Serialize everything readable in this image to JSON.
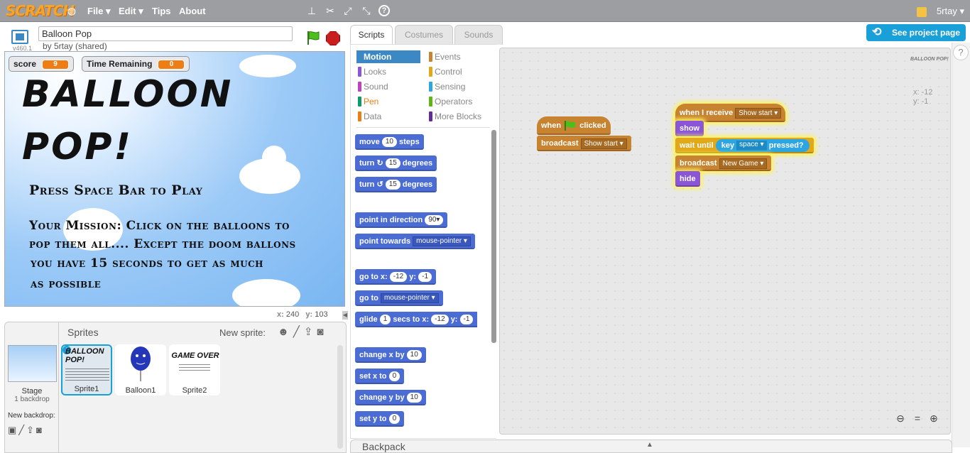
{
  "topbar": {
    "logo": "SCRATCH",
    "menu": [
      "File",
      "Edit",
      "Tips",
      "About"
    ],
    "username": "5rtay"
  },
  "project": {
    "title": "Balloon Pop",
    "byline": "by 5rtay (shared)",
    "version": "v460.1"
  },
  "monitors": {
    "score_label": "score",
    "score_value": "9",
    "time_label": "Time Remaining",
    "time_value": "0"
  },
  "stage_text": {
    "title_line1": "BALLOON",
    "title_line2": "POP!",
    "instruction": "Press Space Bar to Play",
    "mission": [
      "Your Mission: Click on the balloons to",
      "pop them all.... Except the doom ballons",
      "you have 15 seconds to get as much",
      "as possible"
    ]
  },
  "coords": {
    "x_label": "x:",
    "x": "240",
    "y_label": "y:",
    "y": "103"
  },
  "sprites_pane": {
    "header": "Sprites",
    "new_sprite": "New sprite:",
    "stage_label": "Stage",
    "backdrops": "1 backdrop",
    "new_backdrop": "New backdrop:",
    "sprites": [
      "Sprite1",
      "Balloon1",
      "Sprite2"
    ],
    "sprite1_thumb": "BALLOON POP!",
    "sprite2_thumb": "GAME OVER"
  },
  "tabs": [
    "Scripts",
    "Costumes",
    "Sounds"
  ],
  "see_project": "See project page",
  "categories": [
    {
      "label": "Motion",
      "color": "#4a6cd4"
    },
    {
      "label": "Events",
      "color": "#c88330"
    },
    {
      "label": "Looks",
      "color": "#8a55d7"
    },
    {
      "label": "Control",
      "color": "#e1a91a"
    },
    {
      "label": "Sound",
      "color": "#bb42c3"
    },
    {
      "label": "Sensing",
      "color": "#2ca5e2"
    },
    {
      "label": "Pen",
      "color": "#0e9a6c"
    },
    {
      "label": "Operators",
      "color": "#5cb712"
    },
    {
      "label": "Data",
      "color": "#ee7d16"
    },
    {
      "label": "More Blocks",
      "color": "#632d99"
    }
  ],
  "palette": {
    "move": "move",
    "move_n": "10",
    "steps": "steps",
    "turn": "turn",
    "turn_n": "15",
    "degrees": "degrees",
    "point_dir": "point in direction",
    "point_dir_n": "90▾",
    "point_towards": "point towards",
    "mouse_pointer": "mouse-pointer",
    "go_to_x": "go to x:",
    "gx": "-12",
    "y_lbl": "y:",
    "gy": "-1",
    "go_to": "go to",
    "glide": "glide",
    "glide_n": "1",
    "secs_to_x": "secs to x:",
    "change_x": "change x by",
    "cx": "10",
    "set_x": "set x to",
    "sx": "0",
    "change_y": "change y by",
    "cy": "10",
    "set_y": "set y to",
    "sy": "0"
  },
  "scripts": {
    "when": "when",
    "clicked": "clicked",
    "broadcast": "broadcast",
    "show_start": "Show start",
    "when_i_receive": "when I receive",
    "show": "show",
    "wait_until": "wait until",
    "key": "key",
    "space": "space",
    "pressed": "pressed?",
    "new_game": "New Game",
    "hide": "hide"
  },
  "script_area": {
    "xy_x": "x: -12",
    "xy_y": "y: -1",
    "thumb": "BALLOON POP!"
  },
  "backpack": "Backpack"
}
